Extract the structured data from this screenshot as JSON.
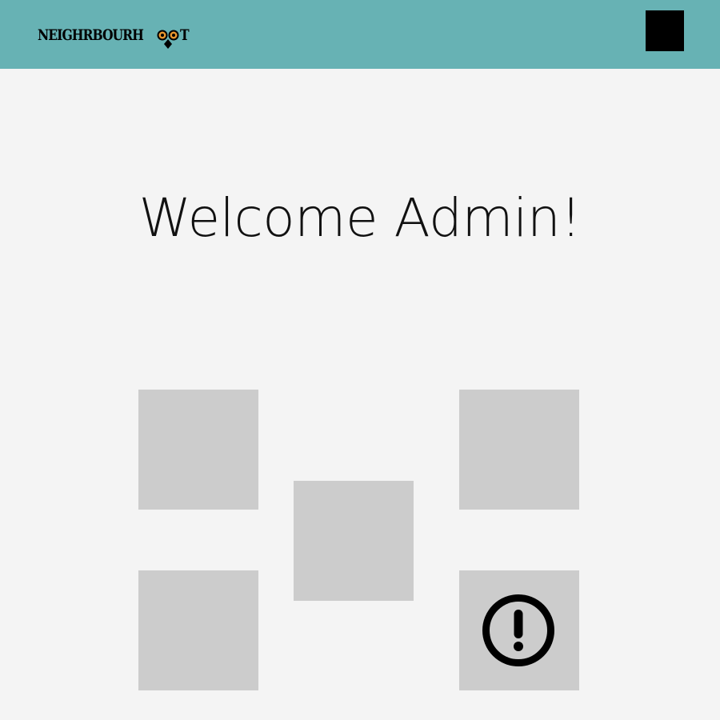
{
  "header": {
    "logo_text_left": "NEIGHRBOURH",
    "logo_text_right": "T",
    "logo_icon": "owl-icon",
    "menu_icon": "menu-icon",
    "background_color": "#67b2b4"
  },
  "main": {
    "welcome_text": "Welcome Admin!",
    "background_color": "#f4f4f4"
  },
  "tiles": {
    "color": "#cccccc",
    "items": [
      {
        "icon": ""
      },
      {
        "icon": ""
      },
      {
        "icon": ""
      },
      {
        "icon": ""
      },
      {
        "icon": "alert-circle-icon"
      }
    ]
  }
}
